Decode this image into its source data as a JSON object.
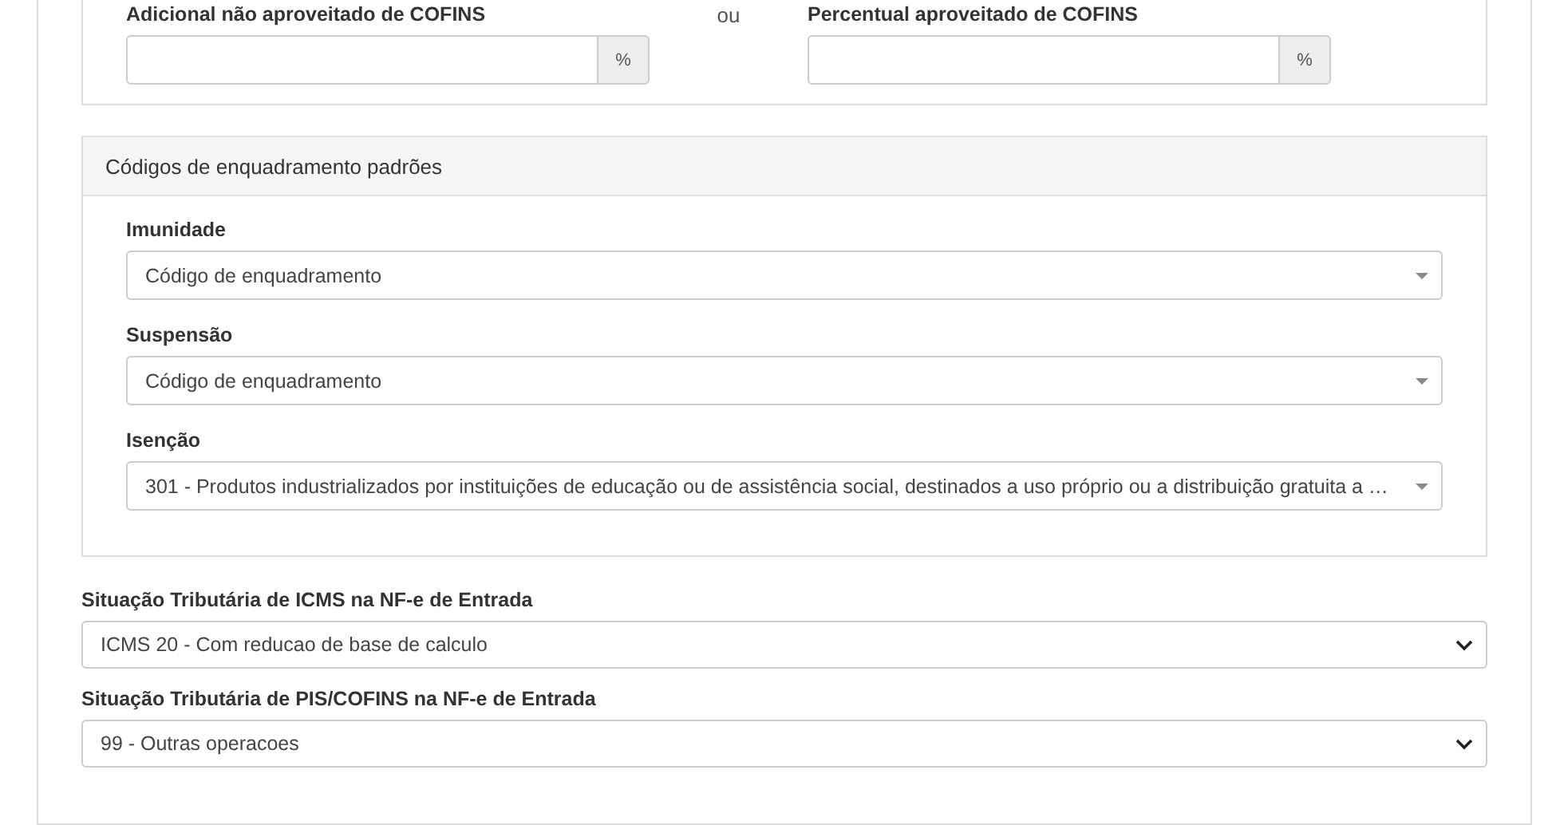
{
  "top_panel": {
    "fields": [
      {
        "label": "Adicional não aproveitado de COFINS",
        "addon": "%"
      },
      {
        "label": "Percentual aproveitado de COFINS",
        "addon": "%"
      }
    ],
    "separator": "ou"
  },
  "codes_panel": {
    "title": "Códigos de enquadramento padrões",
    "fields": [
      {
        "label": "Imunidade",
        "value": "Código de enquadramento"
      },
      {
        "label": "Suspensão",
        "value": "Código de enquadramento"
      },
      {
        "label": "Isenção",
        "value": "301 - Produtos industrializados por instituições de educação ou de assistência social, destinados a uso próprio ou a distribuição gratuita a …"
      }
    ]
  },
  "selects": [
    {
      "label": "Situação Tributária de ICMS na NF-e de Entrada",
      "value": "ICMS 20 - Com reducao de base de calculo"
    },
    {
      "label": "Situação Tributária de PIS/COFINS na NF-e de Entrada",
      "value": "99 - Outras operacoes"
    }
  ]
}
